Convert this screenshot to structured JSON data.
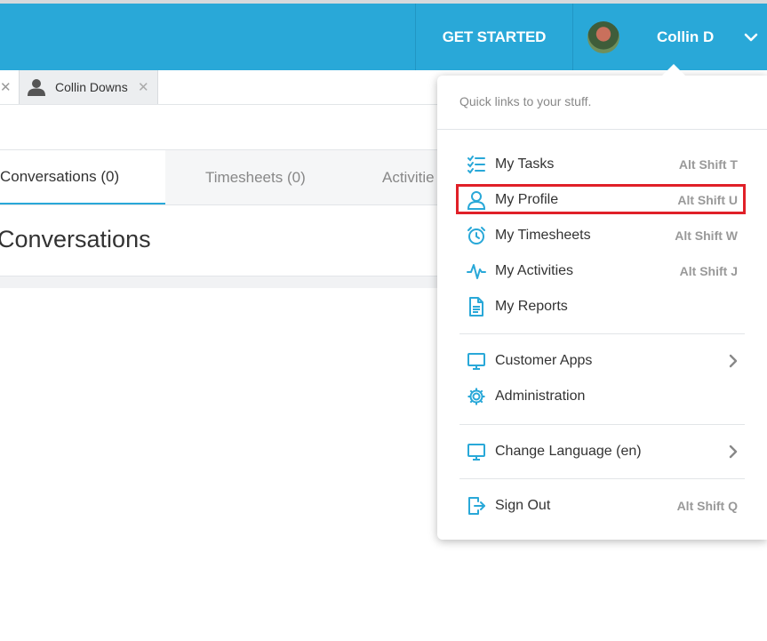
{
  "header": {
    "get_started": "GET STARTED",
    "user_name": "Collin D"
  },
  "tabs": {
    "person_tab": "Collin Downs"
  },
  "subtabs": [
    {
      "label": "Conversations (0)",
      "active": true
    },
    {
      "label": "Timesheets (0)",
      "active": false
    },
    {
      "label": "Activitie",
      "active": false
    }
  ],
  "page": {
    "title": "Conversations"
  },
  "dropdown": {
    "hint": "Quick links to your stuff.",
    "items": [
      {
        "icon": "tasks-icon",
        "label": "My Tasks",
        "shortcut": "Alt Shift T"
      },
      {
        "icon": "profile-icon",
        "label": "My Profile",
        "shortcut": "Alt Shift U"
      },
      {
        "icon": "alarm-clock-icon",
        "label": "My Timesheets",
        "shortcut": "Alt Shift W"
      },
      {
        "icon": "activity-pulse-icon",
        "label": "My Activities",
        "shortcut": "Alt Shift J"
      },
      {
        "icon": "document-icon",
        "label": "My Reports",
        "shortcut": ""
      },
      {
        "icon": "monitor-icon",
        "label": "Customer Apps",
        "shortcut": ""
      },
      {
        "icon": "gear-icon",
        "label": "Administration",
        "shortcut": ""
      },
      {
        "icon": "monitor-icon",
        "label": "Change Language (en)",
        "shortcut": ""
      },
      {
        "icon": "sign-out-icon",
        "label": "Sign Out",
        "shortcut": "Alt Shift Q"
      }
    ]
  },
  "colors": {
    "header_bg": "#29a8d8",
    "accent": "#29a8d8",
    "highlight_box": "#e02028"
  }
}
